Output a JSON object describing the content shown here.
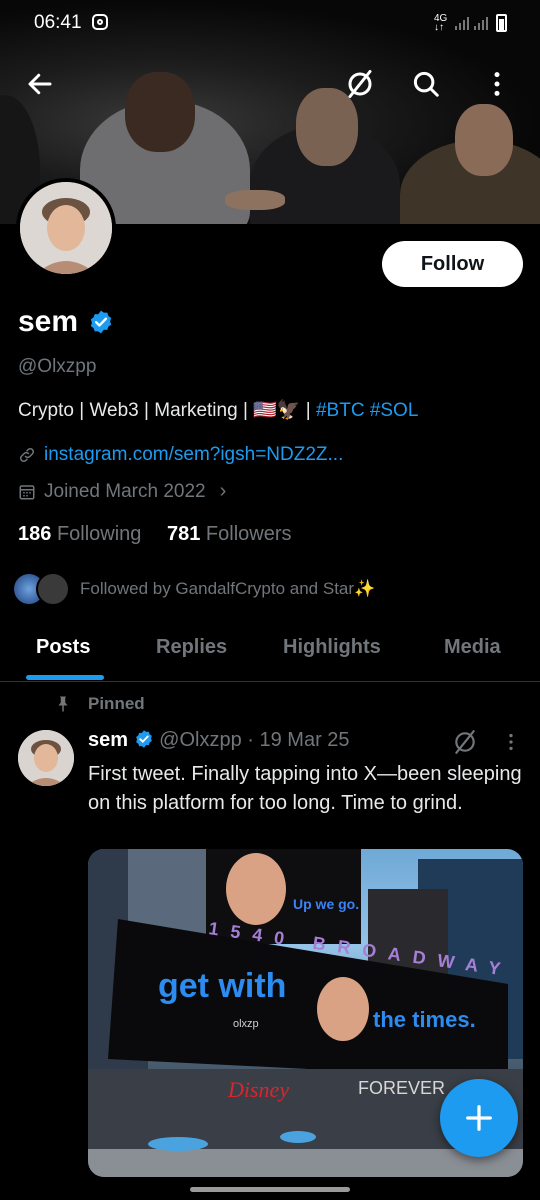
{
  "status_bar": {
    "time": "06:41",
    "network": "4G"
  },
  "profile": {
    "display_name": "sem",
    "handle": "@Olxzpp",
    "bio_text": "Crypto | Web3 | Marketing | 🇺🇸🦅 | ",
    "bio_tags": "#BTC #SOL",
    "link": "instagram.com/sem?igsh=NDZ2Z...",
    "joined": "Joined March 2022",
    "following_count": "186",
    "following_label": "Following",
    "followers_count": "781",
    "followers_label": "Followers",
    "followed_by": "Followed by GandalfCrypto and Star✨",
    "follow_button": "Follow"
  },
  "tabs": [
    {
      "label": "Posts",
      "active": true
    },
    {
      "label": "Replies",
      "active": false
    },
    {
      "label": "Highlights",
      "active": false
    },
    {
      "label": "Media",
      "active": false
    }
  ],
  "post": {
    "pinned_label": "Pinned",
    "author": "sem",
    "handle_date": "@Olxzpp · 19 Mar 25",
    "text": "First tweet. Finally tapping into X—been sleeping on this platform for too long. Time to grind.",
    "media": {
      "billboard_main": "get with",
      "billboard_right": "the times.",
      "billboard_handle": "olxzp",
      "billboard_top": "Up we go.",
      "address": "1540 BROADWAY",
      "sign_bottom": "FOREVER",
      "sign_disney": "Disney"
    }
  },
  "icons": {
    "back": "back-arrow-icon",
    "grok": "grok-icon",
    "search": "search-icon",
    "more": "more-vertical-icon",
    "link": "link-icon",
    "calendar": "calendar-icon",
    "verified": "verified-badge-icon",
    "pin": "pin-icon",
    "compose": "plus-icon"
  },
  "colors": {
    "accent": "#1d9bf0",
    "background": "#000000",
    "secondary_text": "#71767b"
  }
}
